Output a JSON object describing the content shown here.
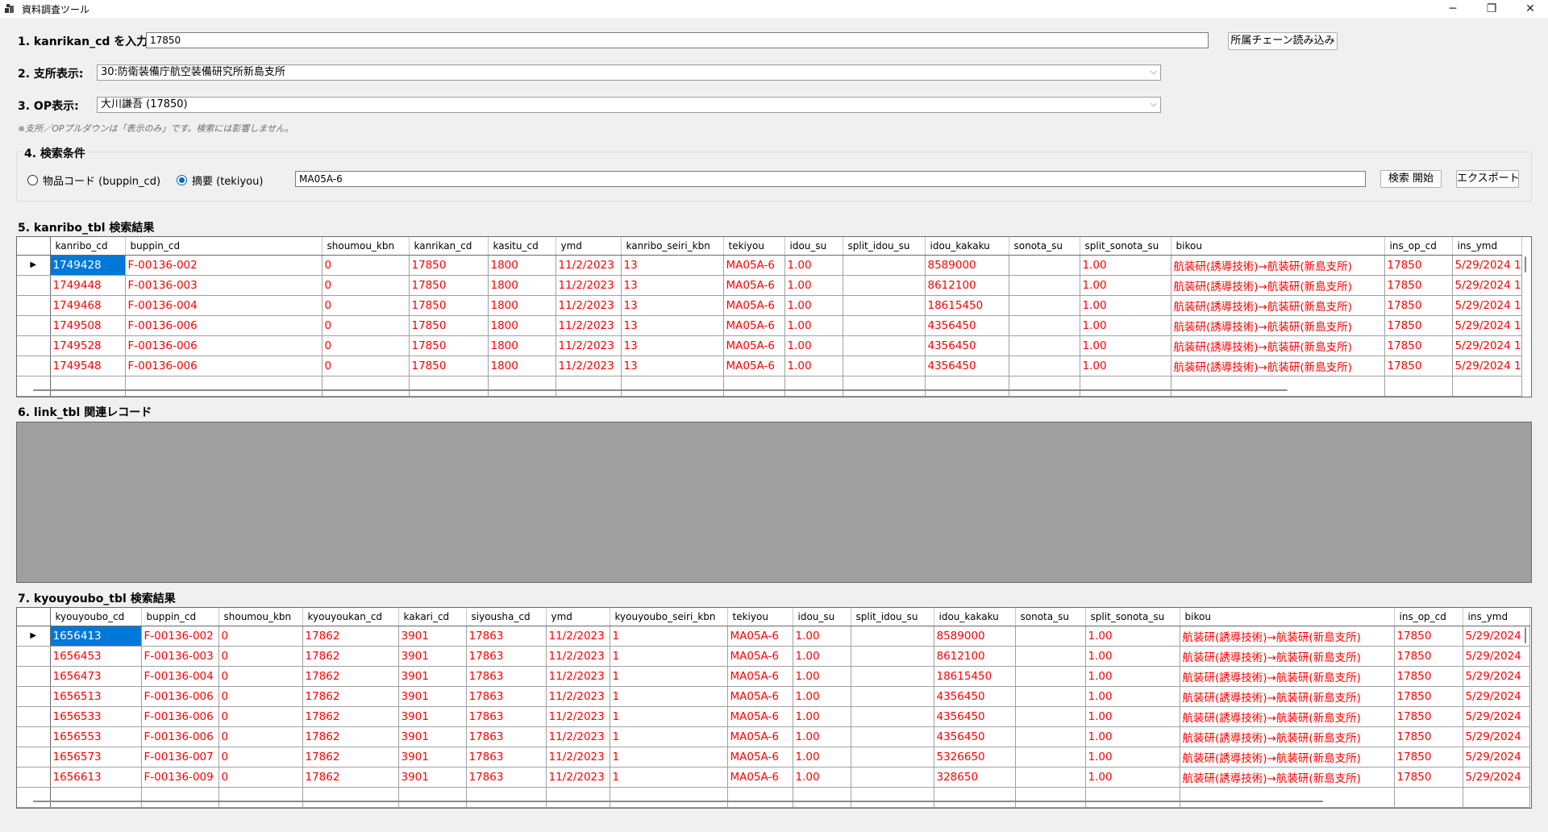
{
  "window": {
    "title": "資料調査ツール",
    "minimize": "─",
    "maximize": "❐",
    "close": "✕"
  },
  "step1": {
    "label": "1. kanrikan_cd を入力:",
    "value": "17850",
    "button": "所属チェーン読み込み"
  },
  "step2": {
    "label": "2. 支所表示:",
    "selected": "30:防衛装備庁航空装備研究所新島支所"
  },
  "step3": {
    "label": "3. OP表示:",
    "selected": "大川謙吾 (17850)"
  },
  "note": "※支所／OPプルダウンは「表示のみ」です。検索には影響しません。",
  "step4": {
    "label": "4. 検索条件",
    "radio1": "物品コード (buppin_cd)",
    "radio2": "摘要 (tekiyou)",
    "radio_selected": "radio2",
    "search_value": "MA05A-6",
    "search_button": "検索 開始",
    "export_button": "エクスポート"
  },
  "step5": {
    "label": "5. kanribo_tbl 検索結果",
    "columns": [
      "kanribo_cd",
      "buppin_cd",
      "shoumou_kbn",
      "kanrikan_cd",
      "kasitu_cd",
      "ymd",
      "kanribo_seiri_kbn",
      "tekiyou",
      "idou_su",
      "split_idou_su",
      "idou_kakaku",
      "sonota_su",
      "split_sonota_su",
      "bikou",
      "ins_op_cd",
      "ins_ymd"
    ],
    "rows": [
      [
        "1749428",
        "F-00136-002",
        "0",
        "17850",
        "1800",
        "11/2/2023",
        "13",
        "MA05A-6",
        "1.00",
        "",
        "8589000",
        "",
        "1.00",
        "航装研(誘導技術)→航装研(新島支所)",
        "17850",
        "5/29/2024 1"
      ],
      [
        "1749448",
        "F-00136-003",
        "0",
        "17850",
        "1800",
        "11/2/2023",
        "13",
        "MA05A-6",
        "1.00",
        "",
        "8612100",
        "",
        "1.00",
        "航装研(誘導技術)→航装研(新島支所)",
        "17850",
        "5/29/2024 1"
      ],
      [
        "1749468",
        "F-00136-004",
        "0",
        "17850",
        "1800",
        "11/2/2023",
        "13",
        "MA05A-6",
        "1.00",
        "",
        "18615450",
        "",
        "1.00",
        "航装研(誘導技術)→航装研(新島支所)",
        "17850",
        "5/29/2024 1"
      ],
      [
        "1749508",
        "F-00136-006",
        "0",
        "17850",
        "1800",
        "11/2/2023",
        "13",
        "MA05A-6",
        "1.00",
        "",
        "4356450",
        "",
        "1.00",
        "航装研(誘導技術)→航装研(新島支所)",
        "17850",
        "5/29/2024 1"
      ],
      [
        "1749528",
        "F-00136-006",
        "0",
        "17850",
        "1800",
        "11/2/2023",
        "13",
        "MA05A-6",
        "1.00",
        "",
        "4356450",
        "",
        "1.00",
        "航装研(誘導技術)→航装研(新島支所)",
        "17850",
        "5/29/2024 1"
      ],
      [
        "1749548",
        "F-00136-006",
        "0",
        "17850",
        "1800",
        "11/2/2023",
        "13",
        "MA05A-6",
        "1.00",
        "",
        "4356450",
        "",
        "1.00",
        "航装研(誘導技術)→航装研(新島支所)",
        "17850",
        "5/29/2024 1"
      ]
    ]
  },
  "step6": {
    "label": "6. link_tbl 関連レコード"
  },
  "step7": {
    "label": "7. kyouyoubo_tbl 検索結果",
    "columns": [
      "kyouyoubo_cd",
      "buppin_cd",
      "shoumou_kbn",
      "kyouyoukan_cd",
      "kakari_cd",
      "siyousha_cd",
      "ymd",
      "kyouyoubo_seiri_kbn",
      "tekiyou",
      "idou_su",
      "split_idou_su",
      "idou_kakaku",
      "sonota_su",
      "split_sonota_su",
      "bikou",
      "ins_op_cd",
      "ins_ymd"
    ],
    "rows": [
      [
        "1656413",
        "F-00136-002",
        "0",
        "17862",
        "3901",
        "17863",
        "11/2/2023",
        "1",
        "MA05A-6",
        "1.00",
        "",
        "8589000",
        "",
        "1.00",
        "航装研(誘導技術)→航装研(新島支所)",
        "17850",
        "5/29/2024"
      ],
      [
        "1656453",
        "F-00136-003",
        "0",
        "17862",
        "3901",
        "17863",
        "11/2/2023",
        "1",
        "MA05A-6",
        "1.00",
        "",
        "8612100",
        "",
        "1.00",
        "航装研(誘導技術)→航装研(新島支所)",
        "17850",
        "5/29/2024"
      ],
      [
        "1656473",
        "F-00136-004",
        "0",
        "17862",
        "3901",
        "17863",
        "11/2/2023",
        "1",
        "MA05A-6",
        "1.00",
        "",
        "18615450",
        "",
        "1.00",
        "航装研(誘導技術)→航装研(新島支所)",
        "17850",
        "5/29/2024"
      ],
      [
        "1656513",
        "F-00136-006",
        "0",
        "17862",
        "3901",
        "17863",
        "11/2/2023",
        "1",
        "MA05A-6",
        "1.00",
        "",
        "4356450",
        "",
        "1.00",
        "航装研(誘導技術)→航装研(新島支所)",
        "17850",
        "5/29/2024"
      ],
      [
        "1656533",
        "F-00136-006",
        "0",
        "17862",
        "3901",
        "17863",
        "11/2/2023",
        "1",
        "MA05A-6",
        "1.00",
        "",
        "4356450",
        "",
        "1.00",
        "航装研(誘導技術)→航装研(新島支所)",
        "17850",
        "5/29/2024"
      ],
      [
        "1656553",
        "F-00136-006",
        "0",
        "17862",
        "3901",
        "17863",
        "11/2/2023",
        "1",
        "MA05A-6",
        "1.00",
        "",
        "4356450",
        "",
        "1.00",
        "航装研(誘導技術)→航装研(新島支所)",
        "17850",
        "5/29/2024"
      ],
      [
        "1656573",
        "F-00136-007",
        "0",
        "17862",
        "3901",
        "17863",
        "11/2/2023",
        "1",
        "MA05A-6",
        "1.00",
        "",
        "5326650",
        "",
        "1.00",
        "航装研(誘導技術)→航装研(新島支所)",
        "17850",
        "5/29/2024"
      ],
      [
        "1656613",
        "F-00136-009",
        "0",
        "17862",
        "3901",
        "17863",
        "11/2/2023",
        "1",
        "MA05A-6",
        "1.00",
        "",
        "328650",
        "",
        "1.00",
        "航装研(誘導技術)→航装研(新島支所)",
        "17850",
        "5/29/2024"
      ]
    ]
  },
  "colors": {
    "row_text": "#ff0000",
    "selection": "#0078d7",
    "empty_panel": "#a0a0a0"
  }
}
